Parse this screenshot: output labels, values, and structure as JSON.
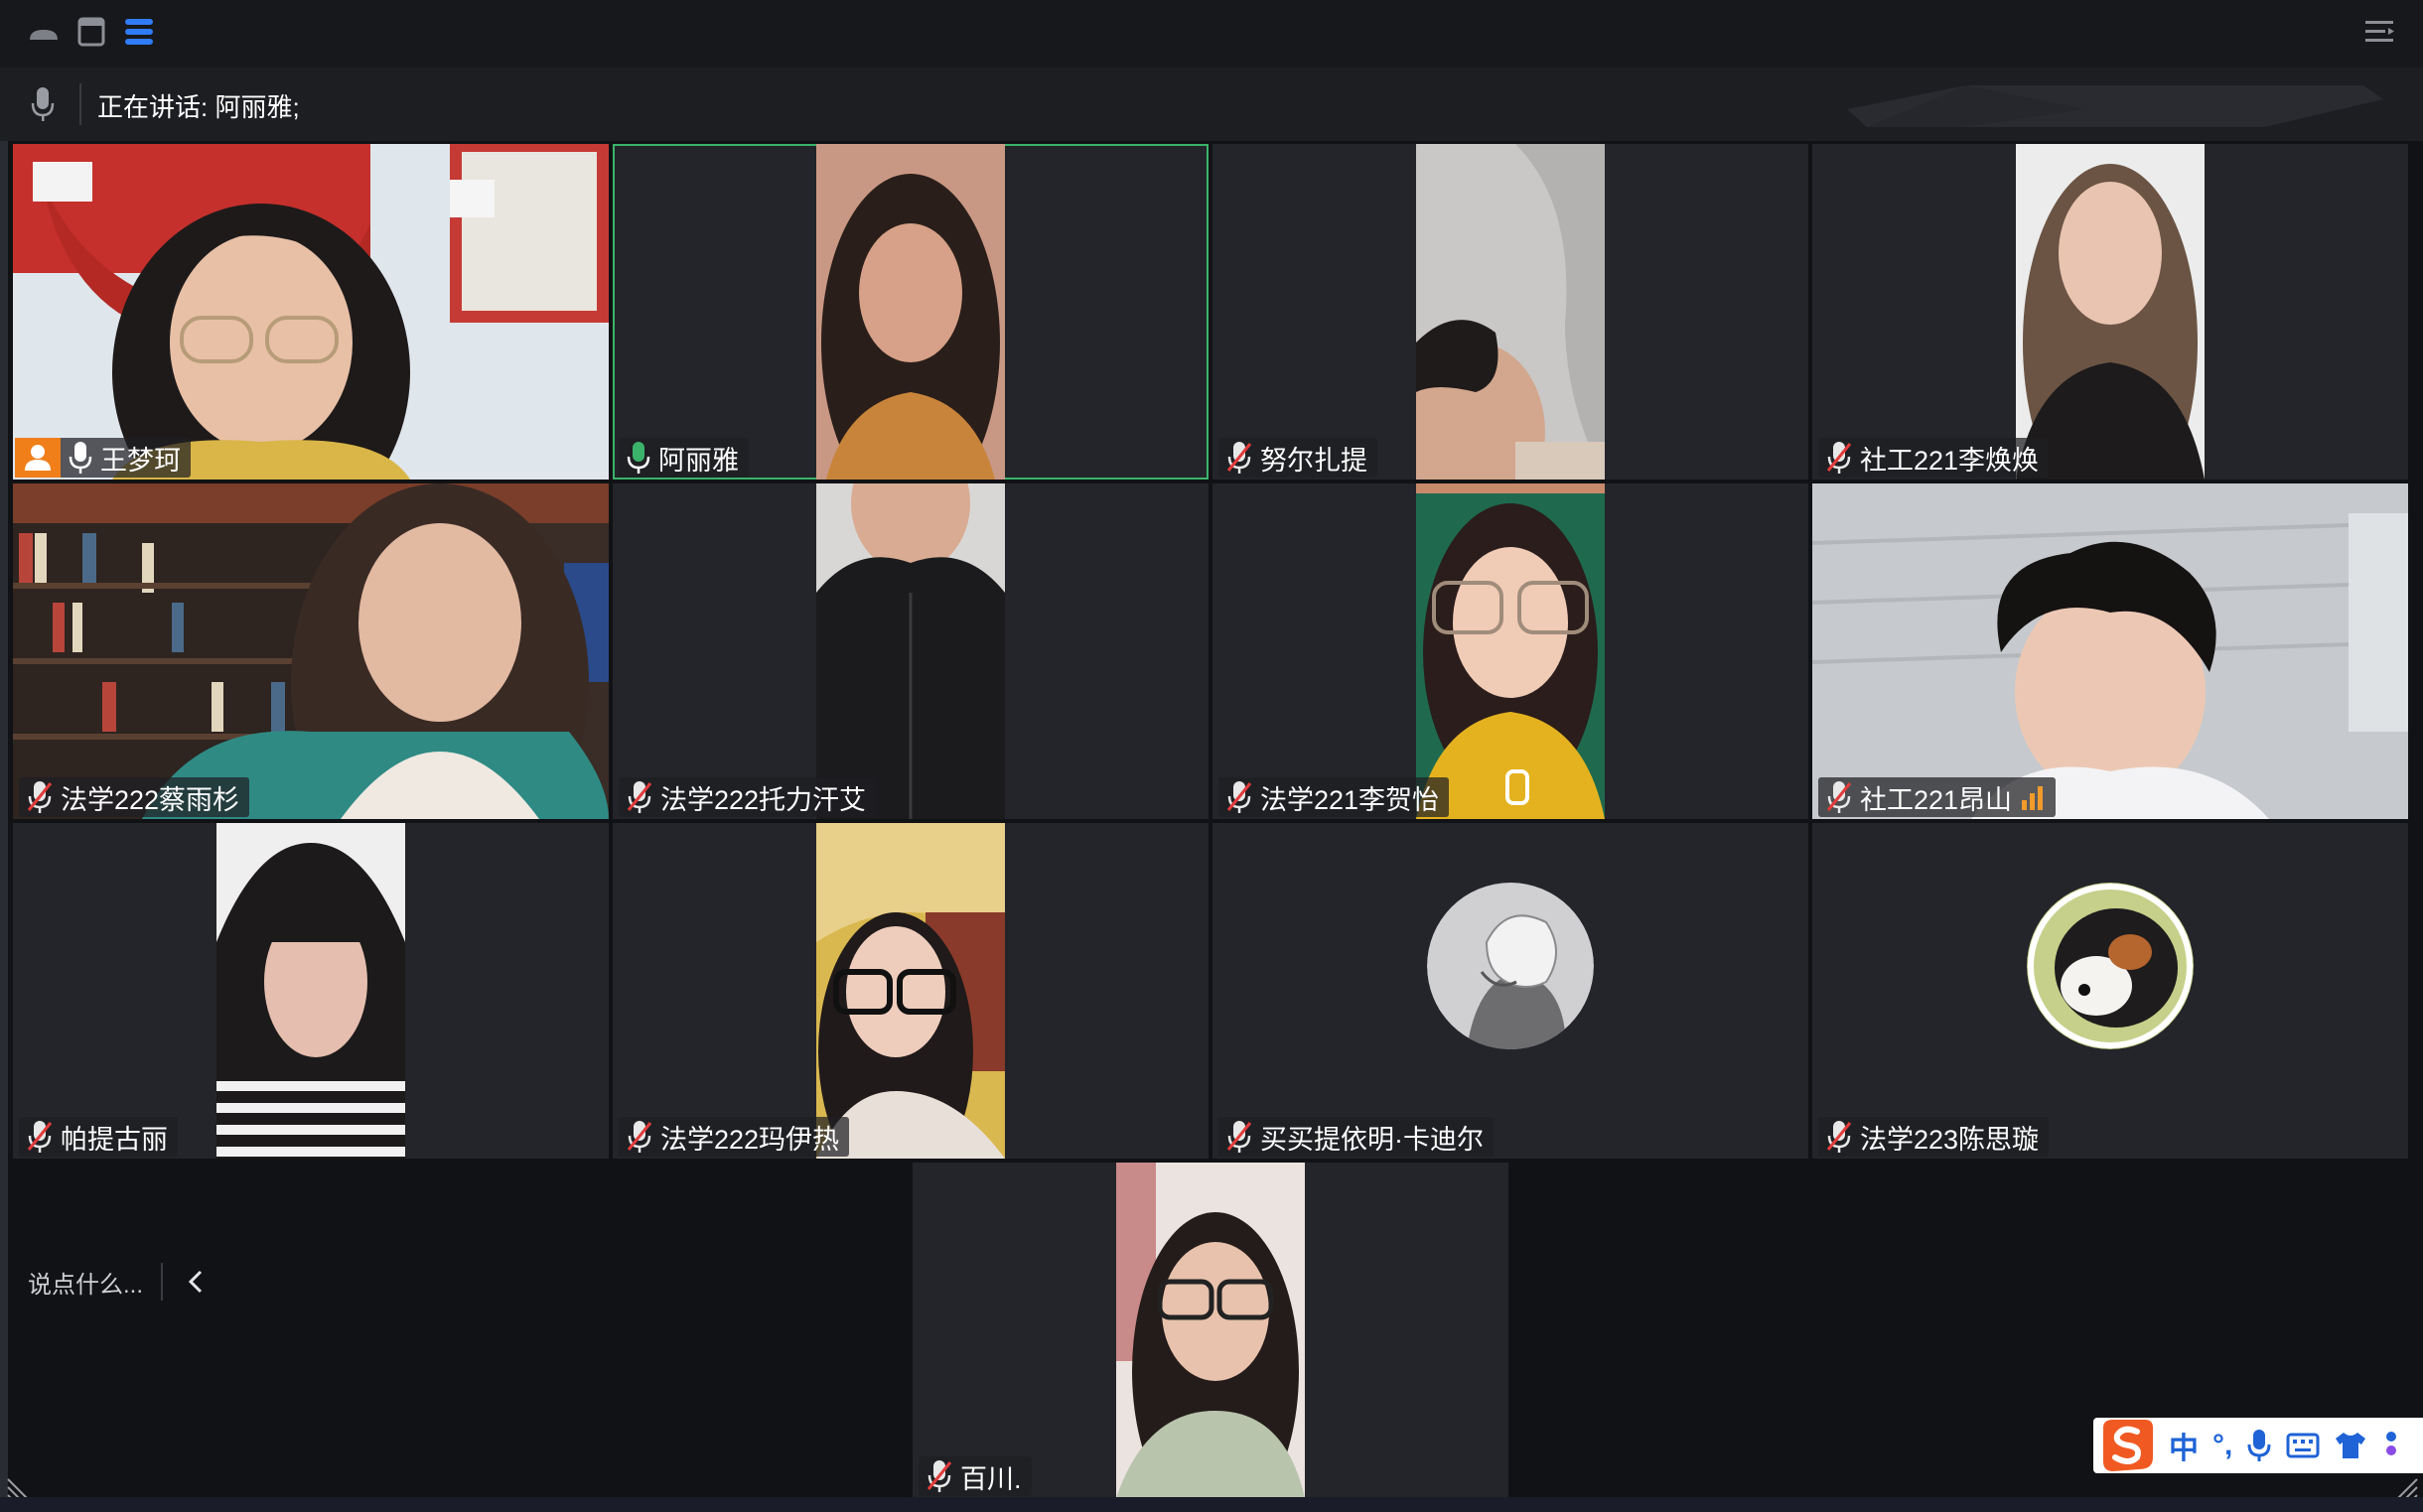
{
  "header": {
    "speaking_text": "正在讲话: 阿丽雅;"
  },
  "participants": [
    {
      "name": "王梦珂",
      "mic": "on",
      "host": true
    },
    {
      "name": "阿丽雅",
      "mic": "on",
      "active": true
    },
    {
      "name": "努尔扎提",
      "mic": "muted"
    },
    {
      "name": "社工221李焕焕",
      "mic": "muted"
    },
    {
      "name": "法学222蔡雨杉",
      "mic": "muted"
    },
    {
      "name": "法学222托力汗艾",
      "mic": "muted"
    },
    {
      "name": "法学221李贺怡",
      "mic": "muted"
    },
    {
      "name": "社工221昂山",
      "mic": "muted",
      "signal": "weak"
    },
    {
      "name": "帕提古丽",
      "mic": "muted"
    },
    {
      "name": "法学222玛伊热",
      "mic": "muted"
    },
    {
      "name": "买买提依明·卡迪尔",
      "mic": "muted",
      "avatar": true
    },
    {
      "name": "法学223陈思璇",
      "mic": "muted",
      "avatar": true
    },
    {
      "name": "百川.",
      "mic": "muted"
    }
  ],
  "chat": {
    "placeholder": "说点什么..."
  },
  "ime": {
    "mode": "中",
    "punctuation": "°,"
  },
  "colors": {
    "active_border": "#3bb36a",
    "muted_icon": "#e0e0e0",
    "host_badge": "#f07f1a",
    "mic_on": "#3bb36a",
    "ime_blue": "#1f63d6",
    "ime_orange": "#f05a22"
  }
}
